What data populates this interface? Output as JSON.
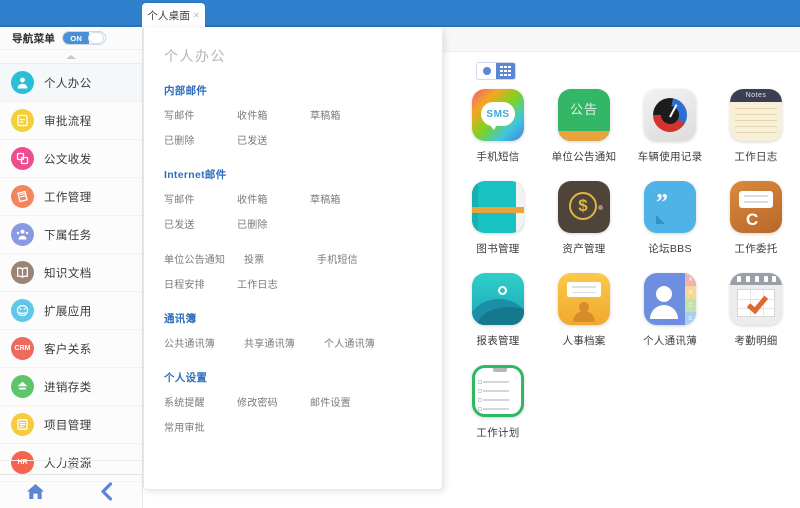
{
  "header": {
    "bg_color": "#3180ce"
  },
  "tab": {
    "label": "个人桌面",
    "close_icon": "✕"
  },
  "sidebar": {
    "nav_toggle": {
      "label": "导航菜单",
      "state": "ON"
    },
    "items": [
      {
        "label": "个人办公",
        "icon": "user-circle-icon",
        "color": "#27c0d6",
        "glyph": ""
      },
      {
        "label": "审批流程",
        "icon": "approval-icon",
        "color": "#f4cf3a",
        "glyph": ""
      },
      {
        "label": "公文收发",
        "icon": "document-exchange-icon",
        "color": "#ee4d8f",
        "glyph": ""
      },
      {
        "label": "工作管理",
        "icon": "work-management-icon",
        "color": "#f4845f",
        "glyph": ""
      },
      {
        "label": "下属任务",
        "icon": "subordinate-task-icon",
        "color": "#8a9ae0",
        "glyph": ""
      },
      {
        "label": "知识文档",
        "icon": "knowledge-book-icon",
        "color": "#9b8376",
        "glyph": ""
      },
      {
        "label": "扩展应用",
        "icon": "extension-app-icon",
        "color": "#5ec8e8",
        "glyph": ""
      },
      {
        "label": "客户关系",
        "icon": "crm-icon",
        "color": "#ef6a5e",
        "glyph": "CRM"
      },
      {
        "label": "进销存类",
        "icon": "inventory-icon",
        "color": "#5fc46a",
        "glyph": ""
      },
      {
        "label": "项目管理",
        "icon": "project-management-icon",
        "color": "#f6cb3d",
        "glyph": ""
      },
      {
        "label": "人力资源",
        "icon": "hr-icon",
        "color": "#f4654e",
        "glyph": "HR"
      }
    ],
    "footer": {
      "home_icon": "home-icon",
      "back_icon": "chevron-left-icon"
    }
  },
  "panel": {
    "title": "个人办公",
    "groups": [
      {
        "title": "内部邮件",
        "links": [
          "写邮件",
          "收件箱",
          "草稿箱",
          "已删除",
          "已发送"
        ]
      },
      {
        "title": "Internet邮件",
        "links": [
          "写邮件",
          "收件箱",
          "草稿箱",
          "已发送",
          "已删除"
        ]
      },
      {
        "title": "",
        "links": [
          "单位公告通知",
          "投票",
          "手机短信",
          "日程安排",
          "工作日志"
        ]
      },
      {
        "title": "通讯簿",
        "links": [
          "公共通讯簿",
          "共享通讯簿",
          "个人通讯簿"
        ]
      },
      {
        "title": "个人设置",
        "links": [
          "系统提醒",
          "修改密码",
          "邮件设置",
          "常用审批"
        ]
      }
    ]
  },
  "content": {
    "view_toggle": {
      "list_icon": "circle-icon",
      "grid_icon": "grid-icon",
      "selected": "grid"
    },
    "apps": [
      {
        "label": "手机短信",
        "icon": "sms-icon",
        "badge": "SMS"
      },
      {
        "label": "单位公告通知",
        "icon": "notice-icon",
        "badge": "公告"
      },
      {
        "label": "车辆使用记录",
        "icon": "gauge-icon",
        "badge": ""
      },
      {
        "label": "工作日志",
        "icon": "notes-icon",
        "badge": "Notes"
      },
      {
        "label": "图书管理",
        "icon": "book-icon",
        "badge": ""
      },
      {
        "label": "资产管理",
        "icon": "asset-coin-icon",
        "badge": "$"
      },
      {
        "label": "论坛BBS",
        "icon": "forum-quote-icon",
        "badge": ""
      },
      {
        "label": "工作委托",
        "icon": "entrust-icon",
        "badge": "C"
      },
      {
        "label": "报表管理",
        "icon": "report-wave-icon",
        "badge": ""
      },
      {
        "label": "人事档案",
        "icon": "hr-file-icon",
        "badge": ""
      },
      {
        "label": "个人通讯薄",
        "icon": "contacts-icon",
        "badge": ""
      },
      {
        "label": "考勤明细",
        "icon": "attendance-calendar-icon",
        "badge": ""
      },
      {
        "label": "工作计划",
        "icon": "work-plan-icon",
        "badge": ""
      }
    ]
  }
}
